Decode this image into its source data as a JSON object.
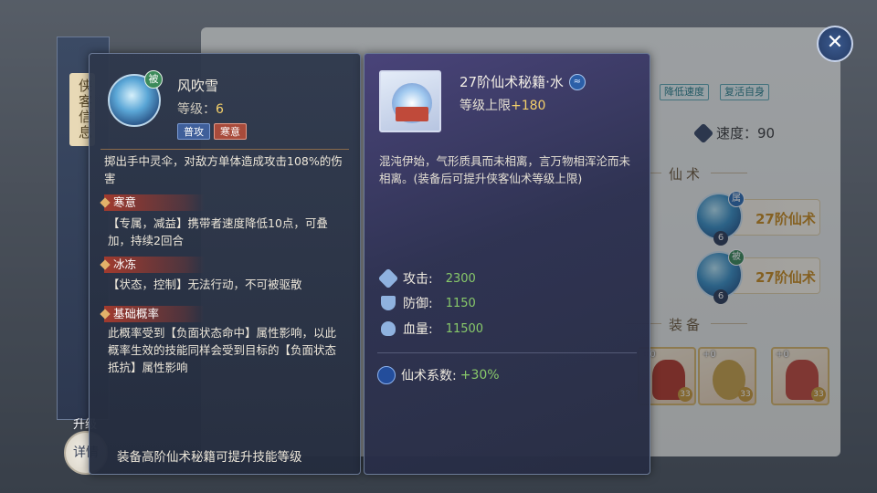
{
  "background_panel": {
    "tags": [
      "降低速度",
      "复活自身"
    ],
    "speed_label": "速度：90",
    "section_skills": "仙术",
    "section_equipment": "装备",
    "skill_slots": [
      {
        "label": "27阶仙术",
        "badge": "属",
        "level": "6"
      },
      {
        "label": "27阶仙术",
        "badge": "被",
        "level": "6"
      }
    ],
    "equipment": [
      {
        "plus": "+0",
        "level": "33"
      },
      {
        "plus": "+0",
        "level": "33"
      },
      {
        "plus": "+0",
        "level": "33"
      }
    ]
  },
  "side_tab": {
    "label": "侠客信息",
    "upgrade_label": "升级",
    "detail_label": "详情"
  },
  "skill_popup": {
    "badge": "被",
    "name": "风吹雪",
    "level_label": "等级：",
    "level_value": "6",
    "tags": [
      "普攻",
      "寒意"
    ],
    "description": "掷出手中灵伞，对敌方单体造成攻击108%的伤害",
    "effects": [
      {
        "title": "寒意",
        "body": "【专属，减益】携带者速度降低10点，可叠加，持续2回合"
      },
      {
        "title": "冰冻",
        "body": "【状态，控制】无法行动，不可被驱散"
      },
      {
        "title": "基础概率",
        "body": "此概率受到【负面状态命中】属性影响，以此概率生效的技能同样会受到目标的【负面状态抵抗】属性影响"
      }
    ],
    "footer": "装备高阶仙术秘籍可提升技能等级"
  },
  "item_popup": {
    "title": "27阶仙术秘籍·水",
    "element_icon": "water-icon",
    "level_cap_label": "等级上限",
    "level_cap_value": "+180",
    "description": "混沌伊始，气形质具而未相离，言万物相浑沦而未相离。(装备后可提升侠客仙术等级上限)",
    "stats": [
      {
        "label": "攻击:",
        "value": "2300"
      },
      {
        "label": "防御:",
        "value": "1150"
      },
      {
        "label": "血量:",
        "value": "11500"
      }
    ],
    "coefficient_label": "仙术系数:",
    "coefficient_value": "+30%"
  },
  "close_glyph": "✕",
  "colors": {
    "accent_gold": "#f4d06a",
    "stat_green": "#88c96a",
    "effect_red": "#a13a2e",
    "panel_navy": "#2e384c"
  }
}
